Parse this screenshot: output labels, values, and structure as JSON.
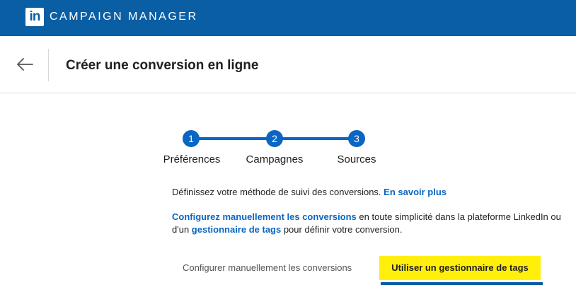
{
  "topbar": {
    "logo_text": "in",
    "app_title": "CAMPAIGN MANAGER"
  },
  "header": {
    "back_icon": "arrow-left-icon",
    "title": "Créer une conversion en ligne"
  },
  "stepper": {
    "steps": [
      {
        "number": "1",
        "label": "Préférences"
      },
      {
        "number": "2",
        "label": "Campagnes"
      },
      {
        "number": "3",
        "label": "Sources"
      }
    ],
    "active_color": "#0a66c2"
  },
  "description": {
    "text": "Définissez votre méthode de suivi des conversions.",
    "link": "En savoir plus"
  },
  "paragraph": {
    "link1": "Configurez manuellement les conversions",
    "text1": " en toute simplicité dans la plateforme LinkedIn ou",
    "text2": "d'un ",
    "link2": "gestionnaire de tags",
    "text3": " pour définir votre conversion."
  },
  "tabs": {
    "manual": "Configurer manuellement les conversions",
    "tags": "Utiliser un gestionnaire de tags",
    "selected": "tags"
  },
  "colors": {
    "brand": "#0a5ea4",
    "link": "#0a66c2",
    "highlight": "#ffef0a"
  }
}
